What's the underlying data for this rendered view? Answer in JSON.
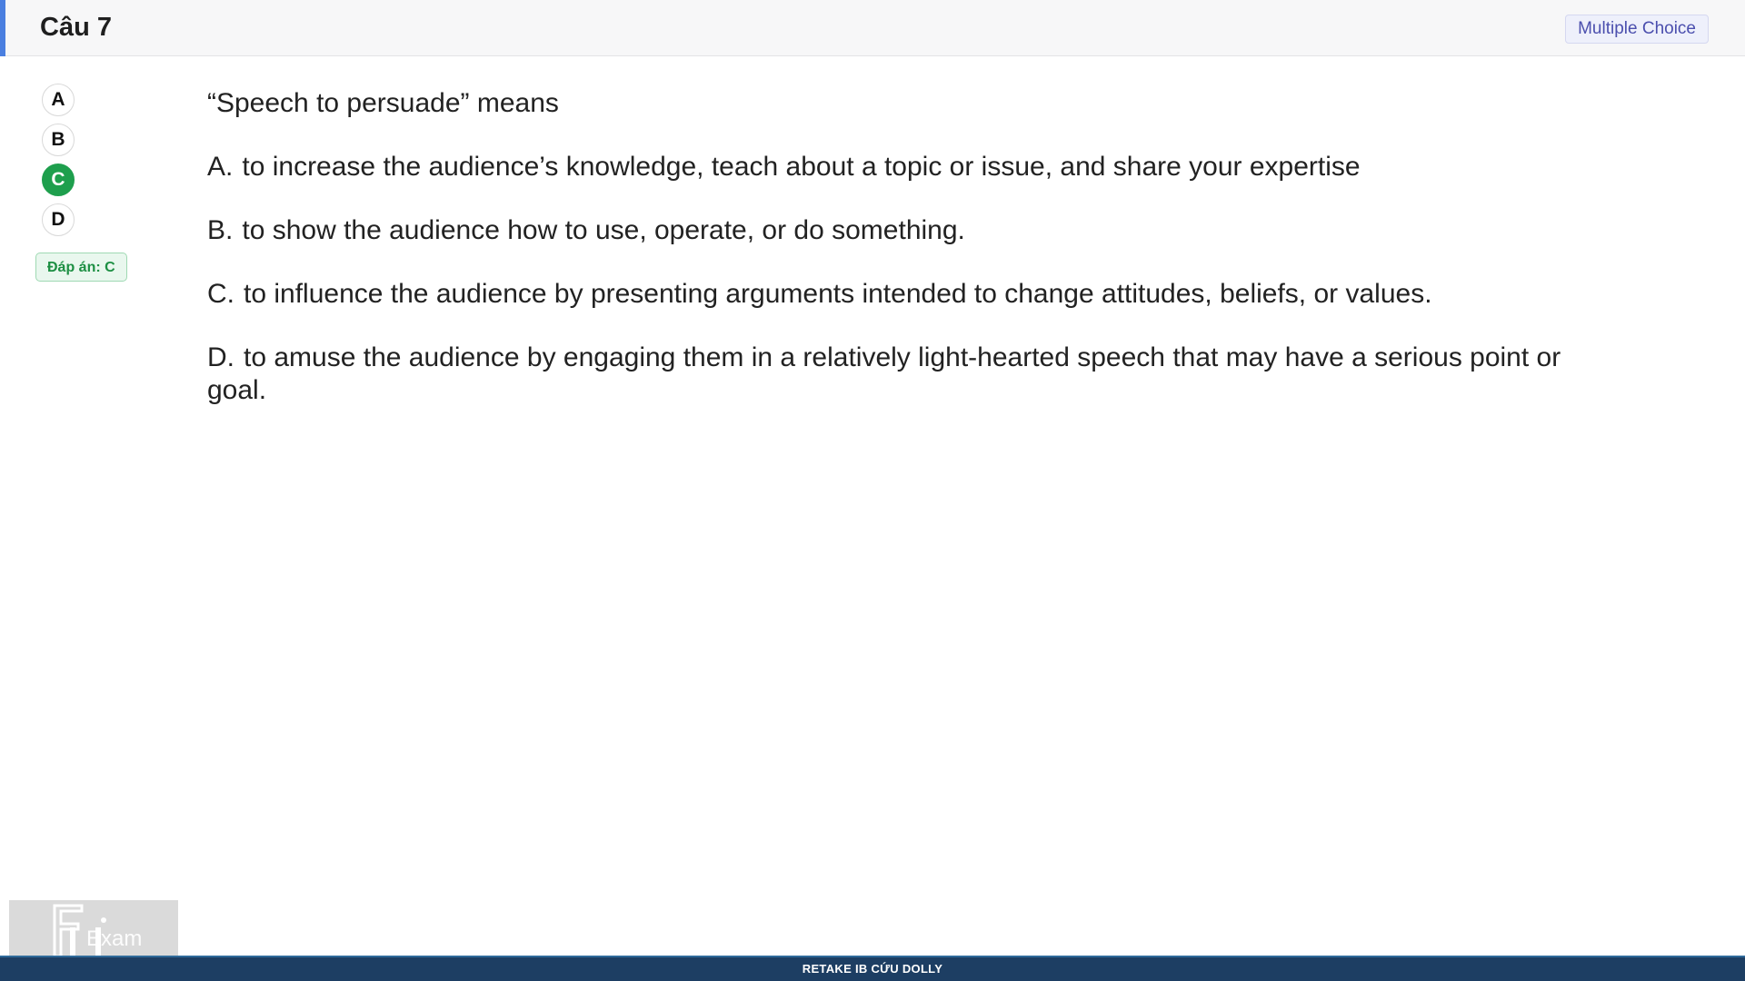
{
  "header": {
    "title": "Câu 7",
    "type_badge": "Multiple Choice"
  },
  "options_nav": {
    "items": [
      {
        "label": "A",
        "correct": false
      },
      {
        "label": "B",
        "correct": false
      },
      {
        "label": "C",
        "correct": true
      },
      {
        "label": "D",
        "correct": false
      }
    ],
    "answer_label": "Đáp án: C"
  },
  "question": {
    "stem": "“Speech to persuade” means",
    "options": [
      {
        "letter": "A.",
        "text": "to increase the audience’s knowledge, teach about a topic or issue, and share your expertise"
      },
      {
        "letter": "B.",
        "text": "to show the audience how to use, operate, or do something."
      },
      {
        "letter": "C.",
        "text": "to influence the audience by presenting arguments intended to change attitudes, beliefs, or values."
      },
      {
        "letter": "D.",
        "text": "to amuse the audience by engaging them in a relatively light-hearted speech that may have a serious point or goal."
      }
    ]
  },
  "footer": {
    "text": "RETAKE IB CỨU DOLLY"
  },
  "logo": {
    "text": "FU Exam"
  },
  "colors": {
    "accent": "#4a7fe0",
    "correct": "#1e9f4d",
    "footer_bg": "#1d3e63",
    "badge_text": "#4b4fae"
  }
}
